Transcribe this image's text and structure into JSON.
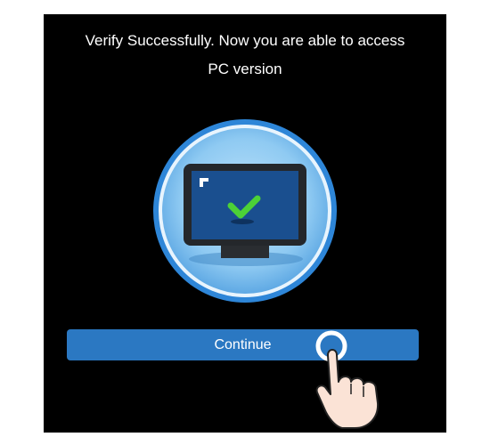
{
  "message": {
    "line1": "Verify Successfully. Now you are able to access",
    "line2": "PC version"
  },
  "continue_label": "Continue",
  "colors": {
    "background": "#000000",
    "button": "#2b78c2",
    "circle_outer": "#2e86d8",
    "circle_inner": "#8fcaf2",
    "screen": "#1a4f8f",
    "check": "#4cd137"
  },
  "icons": {
    "illustration": "monitor-check-icon",
    "hand": "tap-hand-icon"
  }
}
